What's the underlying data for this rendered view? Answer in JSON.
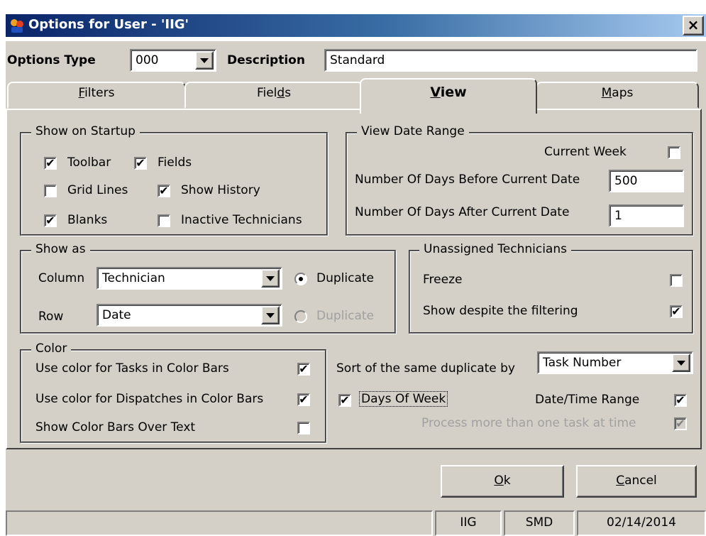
{
  "window": {
    "title": "Options for User - 'IIG'",
    "close_label": "×"
  },
  "options": {
    "type_label": "Options Type",
    "type_value": "000",
    "description_label": "Description",
    "description_value": "Standard"
  },
  "tabs": [
    {
      "pre": "",
      "accel": "F",
      "post": "ilters",
      "active": false
    },
    {
      "pre": "Fiel",
      "accel": "d",
      "post": "s",
      "active": false
    },
    {
      "pre": "",
      "accel": "V",
      "post": "iew",
      "active": true
    },
    {
      "pre": "",
      "accel": "M",
      "post": "aps",
      "active": false
    }
  ],
  "startup": {
    "title": "Show on Startup",
    "toolbar": {
      "label": "Toolbar",
      "checked": true
    },
    "fields": {
      "label": "Fields",
      "checked": true
    },
    "grid_lines": {
      "label": "Grid Lines",
      "checked": false
    },
    "show_history": {
      "label": "Show History",
      "checked": true
    },
    "blanks": {
      "label": "Blanks",
      "checked": true
    },
    "inactive_technicians": {
      "label": "Inactive Technicians",
      "checked": false
    }
  },
  "date_range": {
    "title": "View Date Range",
    "current_week_label": "Current Week",
    "current_week_checked": false,
    "days_before_label": "Number Of Days Before Current Date",
    "days_before_value": "500",
    "days_after_label": "Number Of Days After Current Date",
    "days_after_value": "1"
  },
  "show_as": {
    "title": "Show as",
    "column_label": "Column",
    "column_value": "Technician",
    "column_duplicate_label": "Duplicate",
    "column_duplicate_selected": true,
    "row_label": "Row",
    "row_value": "Date",
    "row_duplicate_label": "Duplicate",
    "row_duplicate_enabled": false
  },
  "unassigned": {
    "title": "Unassigned Technicians",
    "freeze_label": "Freeze",
    "freeze_checked": false,
    "show_despite_label": "Show despite the filtering",
    "show_despite_checked": true
  },
  "color": {
    "title": "Color",
    "tasks_label": "Use color for Tasks in Color Bars",
    "tasks_checked": true,
    "dispatches_label": "Use color for Dispatches in Color Bars",
    "dispatches_checked": true,
    "over_text_label": "Show Color Bars Over Text",
    "over_text_checked": false
  },
  "sort": {
    "label": "Sort of the same duplicate by",
    "value": "Task Number"
  },
  "misc": {
    "days_of_week_label": "Days Of Week",
    "days_of_week_checked": true,
    "date_time_range_label": "Date/Time Range",
    "date_time_range_checked": true,
    "process_more_label": "Process more than one task at time",
    "process_more_checked": true
  },
  "buttons": {
    "ok_accel": "O",
    "ok_rest": "k",
    "cancel_accel": "C",
    "cancel_rest": "ancel"
  },
  "statusbar": {
    "user": "IIG",
    "code": "SMD",
    "date": "02/14/2014"
  },
  "icons": {
    "check": "✔",
    "app": "app-icon"
  },
  "colors": {
    "title_start": "#0a246a",
    "title_end": "#a6caf0",
    "face": "#d4d0c8"
  }
}
